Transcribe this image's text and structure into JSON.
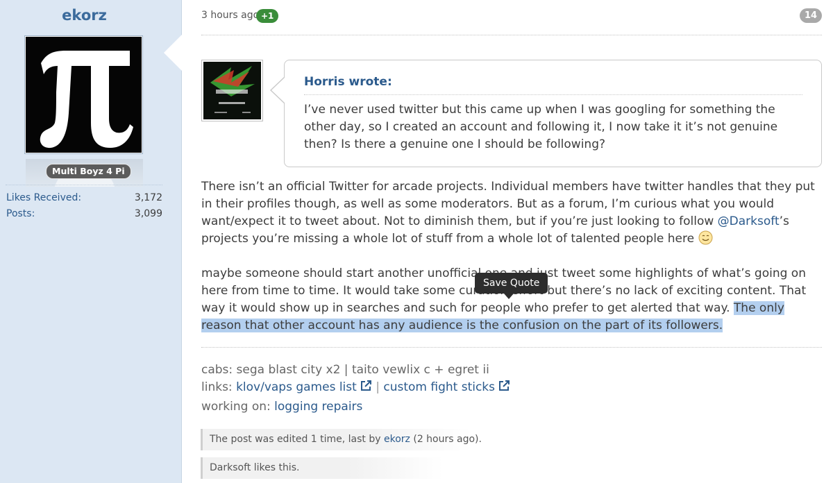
{
  "user": {
    "name": "ekorz",
    "title": "Multi Boyz 4 Pi",
    "stats": [
      {
        "label": "Likes Received:",
        "value": "3,172"
      },
      {
        "label": "Posts:",
        "value": "3,099"
      }
    ]
  },
  "post": {
    "timestamp": "3 hours ago",
    "vote": "+1",
    "number": "14",
    "quote": {
      "author": "Horris wrote:",
      "text": "I’ve never used twitter but this came up when I was googling for something the other day, so I created an account and following it, I now take it it’s not genuine then? Is there a genuine one I should be following?"
    },
    "para1_before": "There isn’t an official Twitter for arcade projects. Individual members have twitter handles that they put in their profiles though, as well as some moderators. But as a forum, I’m curious what you would want/expect it to tweet about. Not to diminish them, but if you’re just looking to follow ",
    "para1_mention": "@Darksoft",
    "para1_after": "’s projects you’re missing a whole lot of stuff from a whole lot of talented people here ",
    "para2_before": "maybe someone should start another unofficial one and just tweet some highlights of what’s going on here from time to time. It would take some curation effort but there’s no lack of exciting content. That way it would show up in searches and such for people who prefer to get alerted that way. ",
    "para2_selected": "The only reason that other account has any audience is the confusion on the part of its followers.",
    "tooltip": "Save Quote",
    "signature": {
      "cabs": "cabs: sega blast city x2 | taito vewlix c + egret ii",
      "links_prefix": "links: ",
      "link1": "klov/vaps games list",
      "link_sep": " | ",
      "link2": "custom fight sticks",
      "working_prefix": "working on: ",
      "working_link": "logging repairs"
    },
    "edited": {
      "prefix": "The post was edited 1 time, last by ",
      "user": "ekorz",
      "suffix": " (2 hours ago)."
    },
    "likes": "Darksoft likes this."
  },
  "colors": {
    "sidebar_bg": "#dce7f3",
    "link": "#2b5a8c",
    "vote_green": "#3a8d3a",
    "selection": "#b3cfef"
  }
}
